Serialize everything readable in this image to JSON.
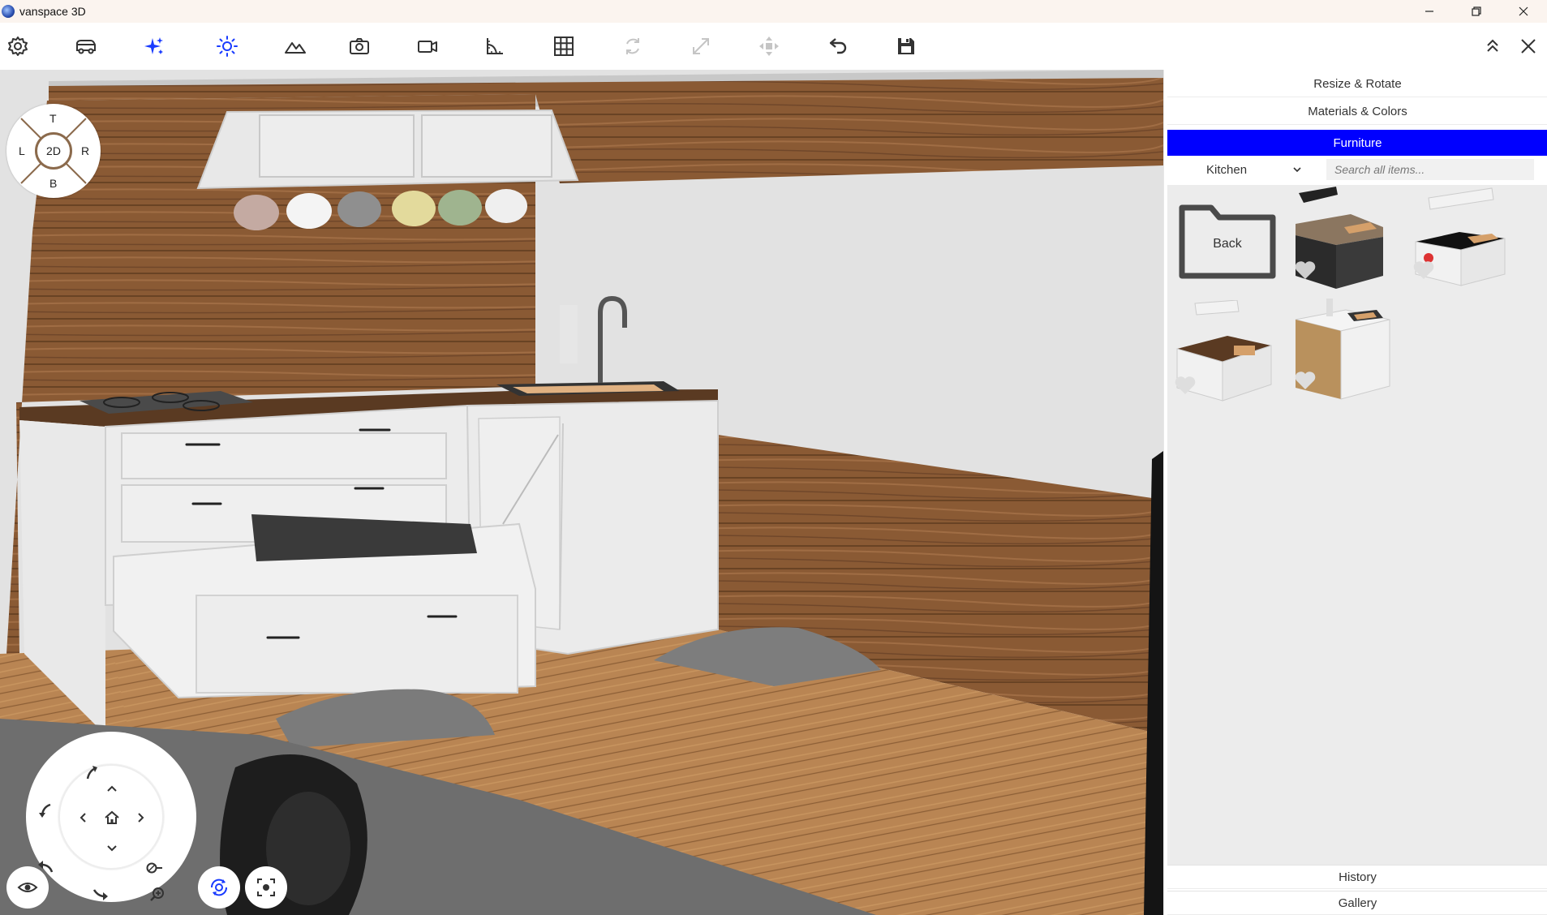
{
  "window": {
    "title": "vanspace 3D"
  },
  "toolbar": {
    "tools": [
      {
        "name": "settings-icon",
        "enabled": true
      },
      {
        "name": "van-icon",
        "enabled": true
      },
      {
        "name": "sparkle-icon",
        "enabled": true
      },
      {
        "name": "sun-icon",
        "enabled": true
      },
      {
        "name": "mountain-icon",
        "enabled": true
      },
      {
        "name": "camera-icon",
        "enabled": true
      },
      {
        "name": "video-icon",
        "enabled": true
      },
      {
        "name": "ruler-angle-icon",
        "enabled": true
      },
      {
        "name": "grid-icon",
        "enabled": true
      },
      {
        "name": "rotate-icon",
        "enabled": false
      },
      {
        "name": "resize-icon",
        "enabled": false
      },
      {
        "name": "move-icon",
        "enabled": false
      },
      {
        "name": "undo-icon",
        "enabled": true
      },
      {
        "name": "save-icon",
        "enabled": true
      }
    ]
  },
  "orientation": {
    "top": "T",
    "left": "L",
    "right": "R",
    "bottom": "B",
    "center": "2D"
  },
  "panel": {
    "sections": {
      "resize_rotate": "Resize & Rotate",
      "materials_colors": "Materials & Colors",
      "furniture": "Furniture",
      "history": "History",
      "gallery": "Gallery"
    },
    "category": {
      "selected": "Kitchen"
    },
    "search": {
      "placeholder": "Search all items..."
    },
    "back_label": "Back"
  },
  "colors": {
    "accent": "#0000ff",
    "icon_blue": "#1a3cff",
    "wood": "#8a5a34",
    "floor": "#b98553"
  }
}
